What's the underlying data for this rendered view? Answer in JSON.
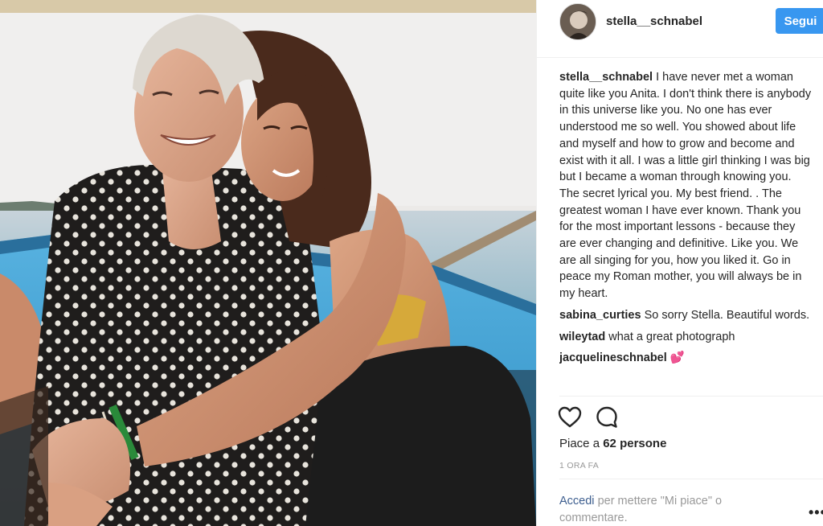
{
  "header": {
    "username": "stella__schnabel",
    "follow_label": "Segui"
  },
  "post": {
    "caption_user": "stella__schnabel",
    "caption_text": "I have never met a woman quite like you Anita. I don't think there is anybody in this universe like you. No one has ever understood me so well. You showed about life and myself and how to grow and become and exist with it all. I was a little girl thinking I was big but I became a woman through knowing you. The secret lyrical you. My best friend. . The greatest woman I have ever known. Thank you for the most important lessons - because they are ever changing and definitive. Like you. We are all singing for you, how you liked it. Go in peace my Roman mother, you will always be in my heart."
  },
  "comments": [
    {
      "user": "sabina_curties",
      "text": "So sorry Stella. Beautiful words."
    },
    {
      "user": "wileytad",
      "text": "what a great photograph"
    },
    {
      "user": "jacquelineschnabel",
      "text": "💕"
    }
  ],
  "actions": {
    "like_icon": "heart-icon",
    "comment_icon": "comment-bubble-icon"
  },
  "likes": {
    "prefix": "Piace a",
    "count": "62 persone"
  },
  "time_ago": "1 ORA FA",
  "login": {
    "link": "Accedi",
    "text": "per mettere \"Mi piace\" o commentare."
  },
  "more_label": "•••",
  "colors": {
    "follow_button": "#3897f0",
    "link": "#3d5e8f",
    "muted": "#999999",
    "text": "#262626"
  }
}
